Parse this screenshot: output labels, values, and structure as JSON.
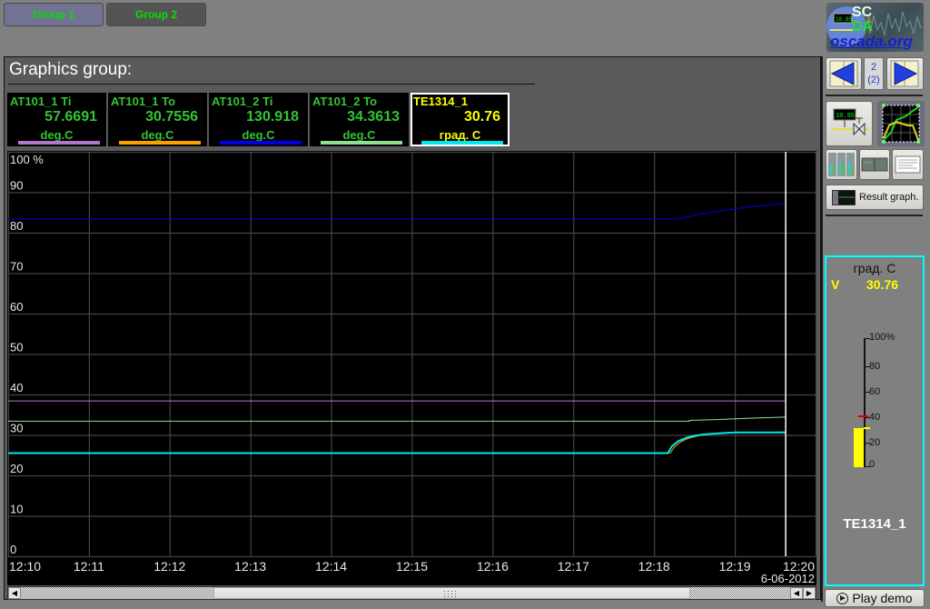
{
  "tabs": [
    {
      "label": "Group 1",
      "active": true
    },
    {
      "label": "Group 2",
      "active": false
    }
  ],
  "panel": {
    "title": "Graphics group:"
  },
  "legend": [
    {
      "name": "AT101_1 Ti",
      "value": "57.6691",
      "unit": "deg.C",
      "color": "#b078c8",
      "text_color": "#33c433",
      "selected": false
    },
    {
      "name": "AT101_1 To",
      "value": "30.7556",
      "unit": "deg.C",
      "color": "#ffa000",
      "text_color": "#33c433",
      "selected": false
    },
    {
      "name": "AT101_2 Ti",
      "value": "130.918",
      "unit": "deg.C",
      "color": "#0000e6",
      "text_color": "#33c433",
      "selected": false
    },
    {
      "name": "AT101_2 To",
      "value": "34.3613",
      "unit": "deg.C",
      "color": "#90e090",
      "text_color": "#33c433",
      "selected": false
    },
    {
      "name": "TE1314_1",
      "value": "30.76",
      "unit": "град. С",
      "color": "#00e8ee",
      "text_color": "#ffff00",
      "selected": true
    }
  ],
  "chart_data": {
    "type": "line",
    "title": "",
    "xlabel": "",
    "ylabel": "%",
    "x_unit": "minutes after 12:10",
    "x_range": [
      0,
      10
    ],
    "y_range": [
      0,
      100
    ],
    "y_ticks": [
      0,
      10,
      20,
      30,
      40,
      50,
      60,
      70,
      80,
      90,
      100
    ],
    "y_tick_labels": [
      "0",
      "10",
      "20",
      "30",
      "40",
      "50",
      "60",
      "70",
      "80",
      "90",
      "100 %"
    ],
    "x_ticks": [
      0,
      1,
      2,
      3,
      4,
      5,
      6,
      7,
      8,
      9,
      10
    ],
    "x_tick_labels": [
      "12:10",
      "12:11",
      "12:12",
      "12:13",
      "12:14",
      "12:15",
      "12:16",
      "12:17",
      "12:18",
      "12:19",
      "12:20"
    ],
    "date_label": "6-06-2012",
    "grid": true,
    "cursor_x": 9.63,
    "series": [
      {
        "name": "AT101_1 Ti",
        "color": "#b078c8",
        "width": 1,
        "points": [
          [
            0,
            38.4
          ],
          [
            9.63,
            38.4
          ]
        ]
      },
      {
        "name": "AT101_2 To",
        "color": "#90e090",
        "width": 1,
        "points": [
          [
            0,
            33.4
          ],
          [
            8.44,
            33.4
          ],
          [
            8.44,
            33.6
          ],
          [
            8.78,
            33.8
          ],
          [
            9.0,
            34.0
          ],
          [
            9.3,
            34.2
          ],
          [
            9.63,
            34.4
          ]
        ]
      },
      {
        "name": "AT101_2 Ti",
        "color": "#0000e6",
        "width": 1,
        "points": [
          [
            0,
            83.4
          ],
          [
            8.28,
            83.4
          ],
          [
            8.5,
            84.3
          ],
          [
            8.75,
            85.2
          ],
          [
            9.0,
            85.9
          ],
          [
            9.25,
            86.5
          ],
          [
            9.5,
            87.0
          ],
          [
            9.63,
            87.2
          ]
        ]
      },
      {
        "name": "AT101_1 To",
        "color": "#ffa000",
        "width": 1,
        "points": [
          [
            0,
            25.5
          ],
          [
            8.2,
            25.5
          ],
          [
            8.25,
            27.0
          ],
          [
            8.33,
            28.3
          ],
          [
            8.43,
            29.2
          ],
          [
            8.55,
            29.8
          ],
          [
            8.7,
            30.2
          ],
          [
            9.0,
            30.6
          ],
          [
            9.63,
            30.7
          ]
        ]
      },
      {
        "name": "TE1314_1",
        "color": "#00e8ee",
        "width": 2,
        "points": [
          [
            0,
            25.5
          ],
          [
            8.17,
            25.5
          ],
          [
            8.22,
            27.2
          ],
          [
            8.3,
            28.5
          ],
          [
            8.4,
            29.3
          ],
          [
            8.5,
            29.8
          ],
          [
            8.6,
            30.1
          ],
          [
            8.8,
            30.4
          ],
          [
            9.0,
            30.6
          ],
          [
            9.63,
            30.6
          ]
        ]
      }
    ]
  },
  "scrollbar": {
    "thumb_start_fraction": 0.25,
    "thumb_size_fraction": 0.62,
    "grip_icon": "grip-dots"
  },
  "sidebar": {
    "logo": {
      "line1": "SC",
      "amp": "&",
      "line2": "DA",
      "site": "oscada.org",
      "display": "10.95"
    },
    "nav": {
      "prev_icon": "arrow-left",
      "next_icon": "arrow-right",
      "page": "2",
      "total": "(2)"
    },
    "mnemo_display": "10.95",
    "result_graph_label": "Result graph."
  },
  "meter": {
    "unit": "град. С",
    "value_label": "V",
    "value": "30.76",
    "scale_labels": [
      "100%",
      "80",
      "60",
      "40",
      "20",
      "0"
    ],
    "level_percent": 30.76,
    "alarm_percent": 40,
    "name": "TE1314_1"
  },
  "play_demo": {
    "label": "Play demo",
    "icon": "play-circle"
  }
}
